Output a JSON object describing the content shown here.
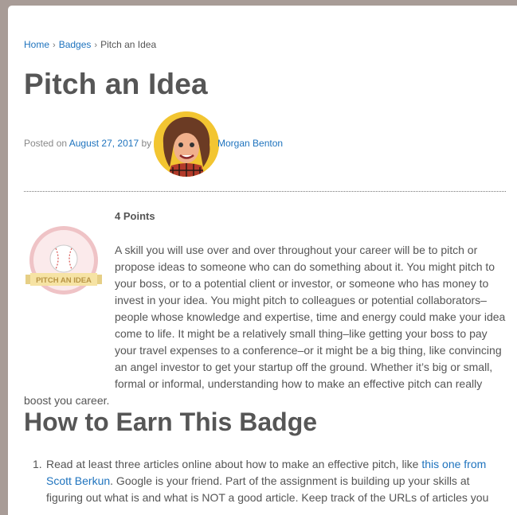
{
  "breadcrumb": {
    "home": "Home",
    "badges": "Badges",
    "current": "Pitch an Idea",
    "separator": "›"
  },
  "post": {
    "title": "Pitch an Idea",
    "posted_on": "Posted on",
    "date": "August 27, 2017",
    "by": "by",
    "author": "Morgan Benton"
  },
  "badge": {
    "banner": "PITCH AN IDEA",
    "icon": "baseball-icon",
    "colors": {
      "circle": "#e9a4aa",
      "inner": "#fbe9ea",
      "banner": "#f6e3a4"
    }
  },
  "content": {
    "points": "4 Points",
    "paragraph": "A skill you will use over and over throughout your career will be to pitch or propose ideas to someone who can do something about it. You might pitch to your boss, or to a potential client or investor, or someone  who has money to invest in your idea. You might pitch to colleagues or potential collaborators–people whose knowledge and expertise, time and energy could make your idea come to life. It might be a relatively small thing–like getting your boss to pay your travel expenses to a conference–or it might be a big thing, like convincing an angel investor to get your startup off the ground. Whether it’s big or small, formal or informal, understanding how to make an effective pitch can really boost you career."
  },
  "section": {
    "title": "How to Earn This Badge"
  },
  "steps": [
    {
      "number": "1.",
      "text_before": "Read at least three articles online about how to make an effective pitch, like ",
      "link": "this one from Scott Berkun",
      "text_after": ". Google is your friend. Part of the assignment is building up your skills at figuring out what is and what is NOT a good article. Keep track of the URLs of articles you"
    }
  ],
  "colors": {
    "link": "#1e73be",
    "text": "#555555",
    "background": "#a89c97"
  }
}
